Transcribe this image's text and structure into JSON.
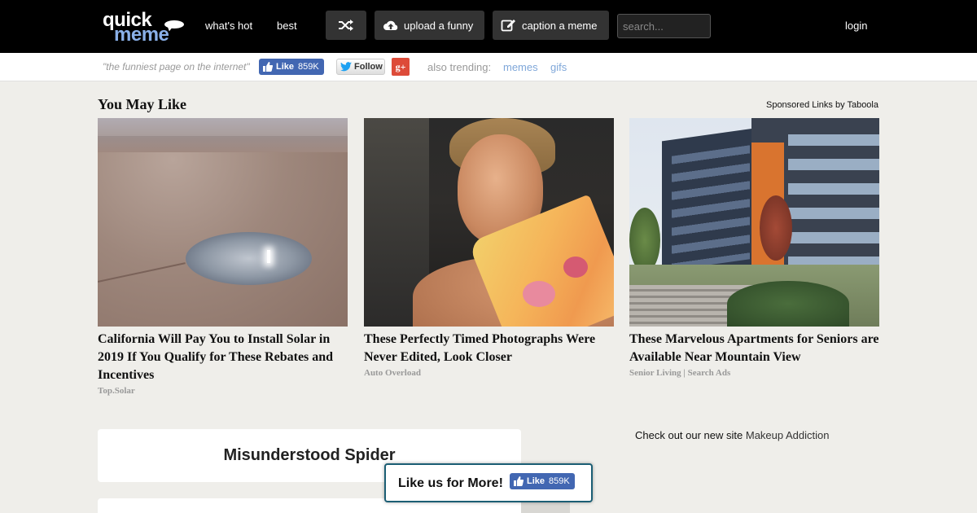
{
  "header": {
    "logo_line1": "quick",
    "logo_line2": "meme",
    "nav": [
      "what's hot",
      "best"
    ],
    "upload_label": "upload a funny",
    "caption_label": "caption a meme",
    "search_placeholder": "search...",
    "login_label": "login"
  },
  "subbar": {
    "tagline": "\"the funniest page on the internet\"",
    "fb_like_label": "Like",
    "fb_like_count": "859K",
    "twitter_follow_label": "Follow",
    "gplus_label": "g+",
    "also_trending_label": "also trending:",
    "trending_links": [
      "memes",
      "gifs"
    ]
  },
  "you_may_like": {
    "title": "You May Like",
    "sponsored": "Sponsored Links by Taboola",
    "cards": [
      {
        "title": "California Will Pay You to Install Solar in 2019 If You Qualify for These Rebates and Incentives",
        "source": "Top.Solar"
      },
      {
        "title": "These Perfectly Timed Photographs Were Never Edited, Look Closer",
        "source": "Auto Overload"
      },
      {
        "title": "These Marvelous Apartments for Seniors are Available Near Mountain View",
        "source": "Senior Living | Search Ads"
      }
    ]
  },
  "meme": {
    "title": "Misunderstood Spider"
  },
  "promo": {
    "text": "Check out our new site",
    "link": "Makeup Addiction"
  },
  "likebox": {
    "text": "Like us for More!",
    "fb_like_label": "Like",
    "fb_like_count": "859K"
  },
  "colors": {
    "topbar": "#000000",
    "page_bg": "#efeeea",
    "accent_link": "#7fa7d9",
    "facebook_blue": "#4267b2"
  }
}
